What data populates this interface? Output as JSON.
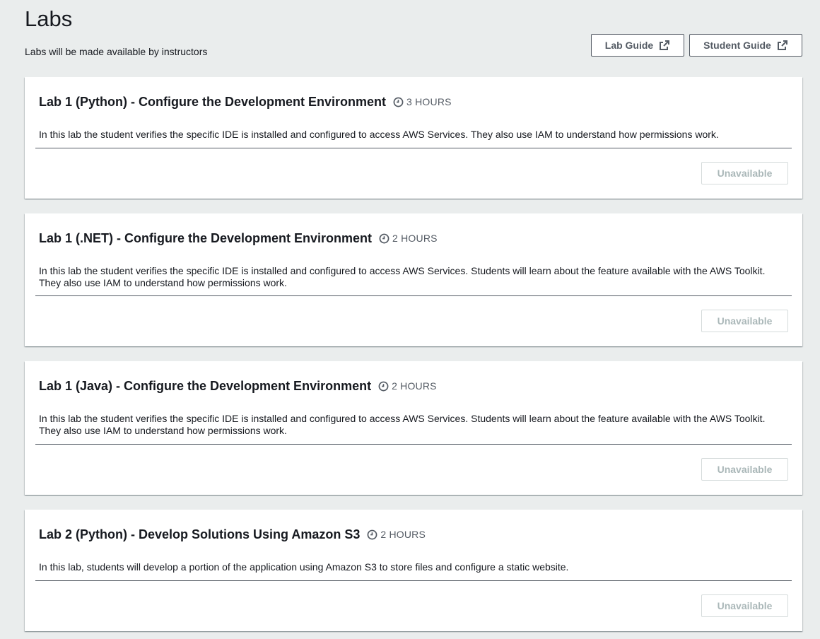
{
  "header": {
    "title": "Labs",
    "subtitle": "Labs will be made available by instructors",
    "lab_guide_label": "Lab Guide",
    "student_guide_label": "Student Guide"
  },
  "labs": [
    {
      "title": "Lab 1 (Python) - Configure the Development Environment",
      "duration": "3 HOURS",
      "description": "In this lab the student verifies the specific IDE is installed and configured to access AWS Services. They also use IAM to understand how permissions work.",
      "button_label": "Unavailable"
    },
    {
      "title": "Lab 1 (.NET) - Configure the Development Environment",
      "duration": "2 HOURS",
      "description": "In this lab the student verifies the specific IDE is installed and configured to access AWS Services. Students will learn about the feature available with the AWS Toolkit. They also use IAM to understand how permissions work.",
      "button_label": "Unavailable"
    },
    {
      "title": "Lab 1 (Java) - Configure the Development Environment",
      "duration": "2 HOURS",
      "description": "In this lab the student verifies the specific IDE is installed and configured to access AWS Services. Students will learn about the feature available with the AWS Toolkit. They also use IAM to understand how permissions work.",
      "button_label": "Unavailable"
    },
    {
      "title": "Lab 2 (Python) - Develop Solutions Using Amazon S3",
      "duration": "2 HOURS",
      "description": "In this lab, students will develop a portion of the application using Amazon S3 to store files and configure a static website.",
      "button_label": "Unavailable"
    }
  ],
  "colors": {
    "page_background": "#eaeded",
    "text_primary": "#16191f",
    "text_secondary": "#545b64",
    "disabled_text": "#aab7b8",
    "disabled_border": "#d5dbdb"
  },
  "icons": {
    "external_link": "external-link-icon",
    "duration": "clock-icon"
  }
}
